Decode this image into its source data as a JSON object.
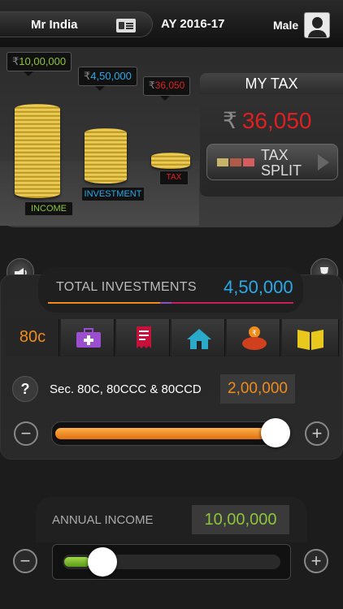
{
  "header": {
    "user_name": "Mr India",
    "assessment_year": "AY 2016-17",
    "gender": "Male"
  },
  "summary": {
    "income_tag": "10,00,000",
    "investment_tag": "4,50,000",
    "tax_tag": "36,050",
    "currency_symbol": "₹",
    "income_label": "INCOME",
    "investment_label": "INVESTMENT",
    "tax_label": "TAX",
    "income_amount": 1000000,
    "investment_amount": 450000,
    "tax_amount": 36050
  },
  "my_tax": {
    "title": "MY TAX",
    "currency": "₹",
    "amount": "36,050",
    "split_button_label": "TAX SPLIT"
  },
  "investments": {
    "label": "TOTAL INVESTMENTS",
    "value": "4,50,000",
    "tabs": [
      {
        "label": "80c",
        "icon": "80c-text"
      },
      {
        "icon": "medical-kit-icon"
      },
      {
        "icon": "receipt-icon"
      },
      {
        "icon": "home-icon"
      },
      {
        "icon": "piggy-bank-icon"
      },
      {
        "icon": "book-icon"
      }
    ],
    "help_label": "?",
    "section_label": "Sec. 80C, 80CCC & 80CCD",
    "section_value": "2,00,000",
    "slider_fill_fraction": 1.0
  },
  "income": {
    "label": "ANNUAL INCOME",
    "value": "10,00,000",
    "slider_fill_fraction": 0.12
  },
  "controls": {
    "minus": "−",
    "plus": "+"
  },
  "colors": {
    "accent_orange": "#f08c1c",
    "accent_blue": "#2aa9e8",
    "tax_red": "#e02020",
    "income_green": "#8ec43c"
  }
}
